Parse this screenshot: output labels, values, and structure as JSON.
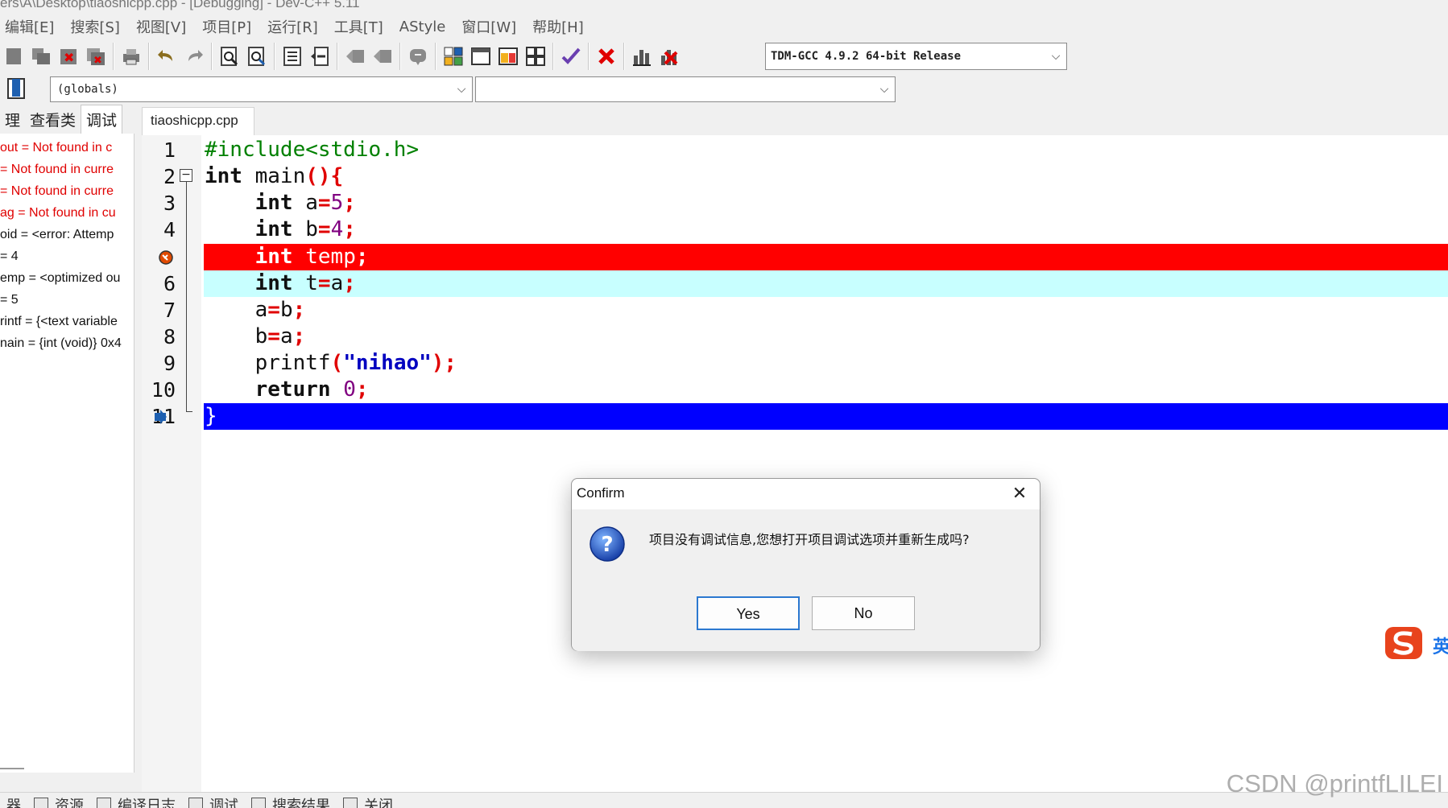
{
  "window": {
    "title_fragment": "ers\\A\\Desktop\\tiaoshicpp.cpp - [Debugging] - Dev-C++ 5.11"
  },
  "menu": [
    "编辑[E]",
    "搜索[S]",
    "视图[V]",
    "项目[P]",
    "运行[R]",
    "工具[T]",
    "AStyle",
    "窗口[W]",
    "帮助[H]"
  ],
  "toolbar": {
    "compiler": "TDM-GCC 4.9.2 64-bit Release"
  },
  "scope_bar": {
    "scope": "(globals)",
    "function": ""
  },
  "left_panel": {
    "tabs": [
      "理",
      "查看类",
      "调试"
    ],
    "active_tab": "调试",
    "watches": [
      {
        "text": "out = Not found in c",
        "kind": "err"
      },
      {
        "text": "= Not found in curre",
        "kind": "err"
      },
      {
        "text": "= Not found in curre",
        "kind": "err"
      },
      {
        "text": "ag = Not found in cu",
        "kind": "err"
      },
      {
        "text": "oid = <error: Attemp",
        "kind": "ok"
      },
      {
        "text": "= 4",
        "kind": "ok"
      },
      {
        "text": "emp = <optimized ou",
        "kind": "ok"
      },
      {
        "text": "= 5",
        "kind": "ok"
      },
      {
        "text": "rintf = {<text variable",
        "kind": "ok"
      },
      {
        "text": "nain = {int (void)} 0x4",
        "kind": "ok"
      }
    ]
  },
  "editor": {
    "tab": "tiaoshicpp.cpp",
    "line_numbers": [
      "1",
      "2",
      "3",
      "4",
      "",
      "6",
      "7",
      "8",
      "9",
      "10",
      "11"
    ]
  },
  "dialog": {
    "title": "Confirm",
    "message": "项目没有调试信息,您想打开项目调试选项并重新生成吗?",
    "yes": "Yes",
    "no": "No"
  },
  "ime": {
    "label": "英"
  },
  "bottom_tabs": [
    "器",
    "资源",
    "编译日志",
    "调试",
    "搜索结果",
    "关闭"
  ],
  "watermark": "CSDN @printfLILEI",
  "colors": {
    "breakpoint_line": "#ff0000",
    "current_line": "#c8ffff",
    "selected_line": "#0000ff",
    "error_text": "#e00000"
  }
}
